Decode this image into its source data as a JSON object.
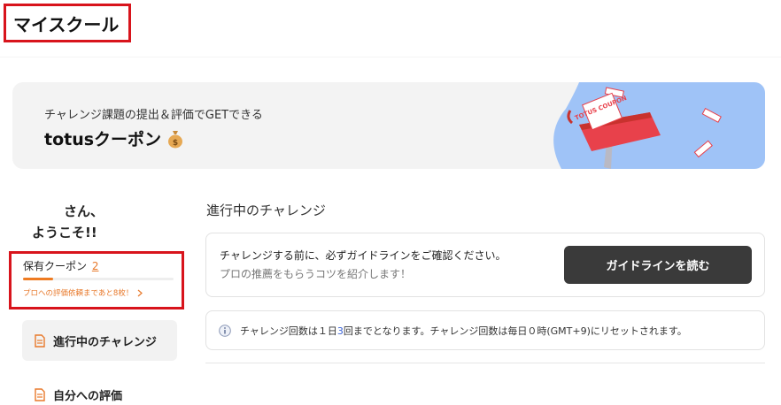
{
  "page": {
    "title": "マイスクール"
  },
  "banner": {
    "subtitle": "チャレンジ課題の提出＆評価でGETできる",
    "title": "totusクーポン",
    "icon": "moneybag-icon",
    "coupon_art_text": "TOTUS COUPON",
    "background": "#f3f3f3",
    "art_color": "#9fc3f7",
    "mailbox_color": "#e8414b"
  },
  "greeting": {
    "name": "さん、",
    "welcome": "ようこそ!!"
  },
  "coupon": {
    "label": "保有クーポン",
    "count": "2",
    "progress_fraction": 0.2,
    "note": "プロへの評価依頼まであと8枚！",
    "note_icon": "chevron-right-icon",
    "accent": "#e8792b"
  },
  "sidebar": {
    "items": [
      {
        "label": "進行中のチャレンジ",
        "icon": "document-icon",
        "active": true
      },
      {
        "label": "自分への評価",
        "icon": "document-icon",
        "active": false
      }
    ]
  },
  "main": {
    "section_title": "進行中のチャレンジ",
    "guide": {
      "line1": "チャレンジする前に、必ずガイドラインをご確認ください。",
      "line2": "プロの推薦をもらうコツを紹介します！",
      "button_label": "ガイドラインを読む"
    },
    "info": {
      "icon": "info-icon",
      "text_before": "チャレンジ回数は１日",
      "count": "3",
      "text_after": "回までとなります。チャレンジ回数は毎日０時(GMT+9)にリセットされます。"
    }
  }
}
